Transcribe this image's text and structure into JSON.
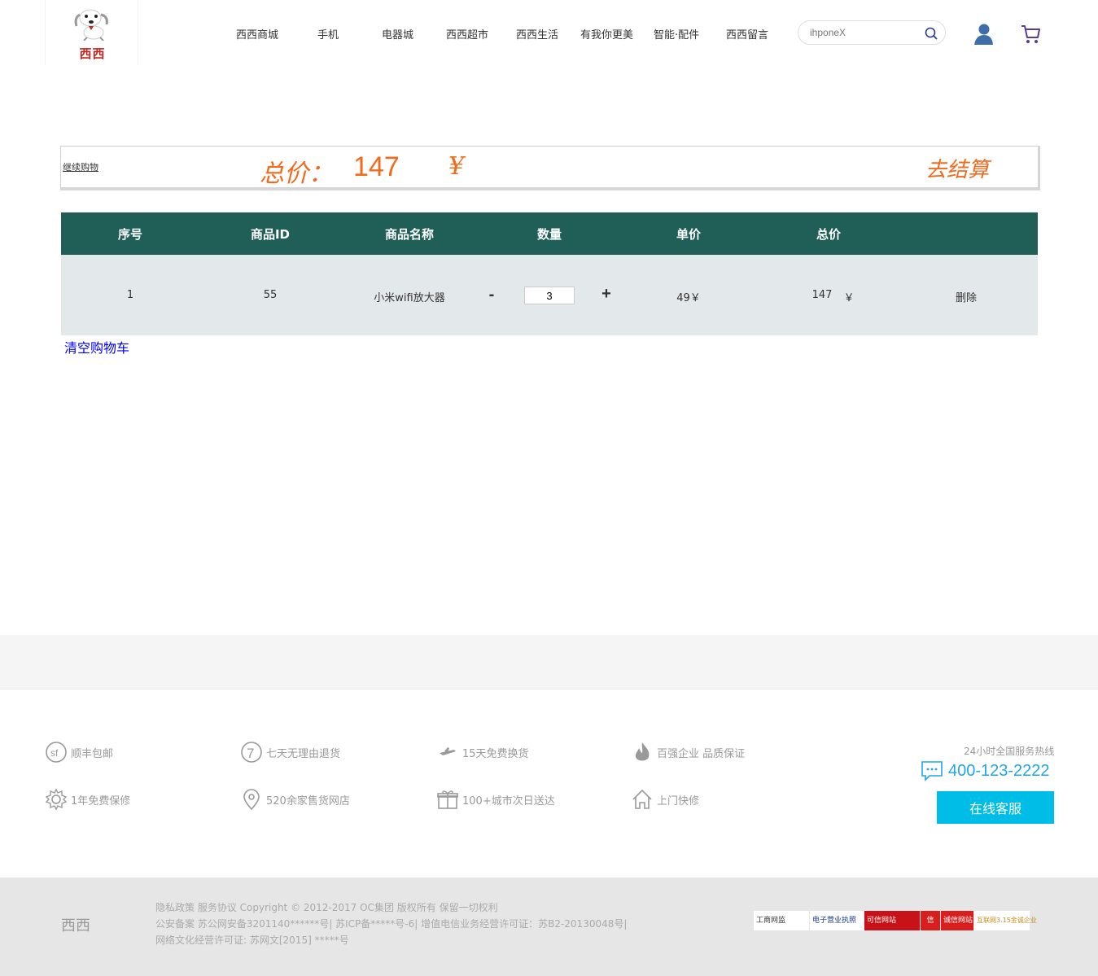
{
  "header": {
    "brand": "西西",
    "nav": [
      "西西商城",
      "手机",
      "电器城",
      "西西超市",
      "西西生活",
      "有我你更美",
      "智能·配件",
      "西西留言"
    ],
    "search_placeholder": "ihponeX"
  },
  "summary": {
    "continue_label": "继续购物",
    "total_label": "总价：",
    "total_value": "147",
    "currency": "¥",
    "checkout_label": "去结算"
  },
  "table": {
    "headers": [
      "序号",
      "商品ID",
      "商品名称",
      "数量",
      "单价",
      "总价"
    ],
    "rows": [
      {
        "index": "1",
        "id": "55",
        "name": "小米wifi放大器",
        "minus": "-",
        "qty": "3",
        "plus": "+",
        "unit_price": "49￥",
        "total": "147",
        "total_currency": "￥",
        "delete": "删除"
      }
    ],
    "clear_label": "清空购物车"
  },
  "footer": {
    "services": [
      "顺丰包邮",
      "七天无理由退货",
      "15天免费换货",
      "百强企业 品质保证",
      "1年免费保修",
      "520余家售货网店",
      "100+城市次日送达",
      "上门快修"
    ],
    "hotline_label": "24小时全国服务热线",
    "hotline": "400-123-2222",
    "online_service": "在线客服",
    "bottom_brand": "西西",
    "legal_lines": [
      "隐私政策 服务协议 Copyright © 2012-2017 OC集团 版权所有 保留一切权利",
      "公安备案 苏公网安备3201140******号| 苏ICP备*****号-6| 增值电信业务经营许可证：苏B2-20130048号|",
      "网络文化经营许可证: 苏网文[2015] *****号"
    ],
    "badges": [
      "工商网监",
      "电子营业执照",
      "可信网站",
      "信",
      "诚信网站",
      "互联网3.15金诚企业"
    ]
  },
  "colors": {
    "table_header": "#1f5f57",
    "table_row": "#e3e9ea",
    "price_orange": "#f26b1d",
    "accent_blue": "#00bde8",
    "logo_red": "#c0261f"
  }
}
